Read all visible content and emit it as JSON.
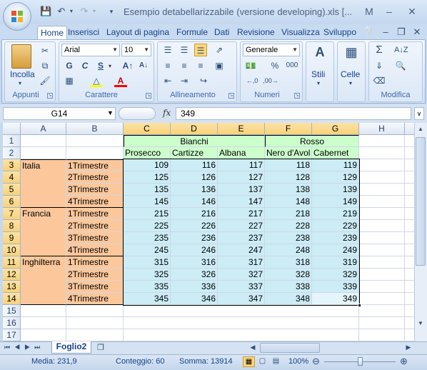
{
  "window": {
    "title": "Esempio detabellarizzabile (versione developing).xls  [...",
    "min_label": "M",
    "restore_label": "–",
    "close_label": "✕"
  },
  "tabs": [
    "Home",
    "Inserisci",
    "Layout di pagina",
    "Formule",
    "Dati",
    "Revisione",
    "Visualizza",
    "Sviluppo"
  ],
  "ribbon": {
    "clipboard": {
      "paste_label": "Incolla",
      "group_label": "Appunti"
    },
    "font": {
      "font_name": "Arial",
      "font_size": "10",
      "group_label": "Carattere",
      "bold": "G",
      "italic": "C",
      "underline": "S"
    },
    "alignment": {
      "group_label": "Allineamento"
    },
    "number": {
      "format": "Generale",
      "percent": "%",
      "thousands": "000",
      "group_label": "Numeri"
    },
    "styles": {
      "label": "Stili"
    },
    "cells": {
      "label": "Celle"
    },
    "editing": {
      "group_label": "Modifica"
    }
  },
  "formula": {
    "name_box": "G14",
    "fx_label": "fx",
    "value": "349"
  },
  "columns": [
    "A",
    "B",
    "C",
    "D",
    "E",
    "F",
    "G",
    "H"
  ],
  "rows": [
    "1",
    "2",
    "3",
    "4",
    "5",
    "6",
    "7",
    "8",
    "9",
    "10",
    "11",
    "12",
    "13",
    "14",
    "15",
    "16",
    "17"
  ],
  "header1": {
    "bianchi": "Bianchi",
    "rosso": "Rosso"
  },
  "header2": [
    "Prosecco",
    "Cartizze",
    "Albana",
    "Nero d'Avol",
    "Cabernet"
  ],
  "countries": [
    "Italia",
    "Francia",
    "Inghilterra"
  ],
  "quarters": [
    "1Trimestre",
    "2Trimestre",
    "3Trimestre",
    "4Trimestre"
  ],
  "table": [
    [
      "109",
      "116",
      "117",
      "118",
      "119"
    ],
    [
      "125",
      "126",
      "127",
      "128",
      "129"
    ],
    [
      "135",
      "136",
      "137",
      "138",
      "139"
    ],
    [
      "145",
      "146",
      "147",
      "148",
      "149"
    ],
    [
      "215",
      "216",
      "217",
      "218",
      "219"
    ],
    [
      "225",
      "226",
      "227",
      "228",
      "229"
    ],
    [
      "235",
      "236",
      "237",
      "238",
      "239"
    ],
    [
      "245",
      "246",
      "247",
      "248",
      "249"
    ],
    [
      "315",
      "316",
      "317",
      "318",
      "319"
    ],
    [
      "325",
      "326",
      "327",
      "328",
      "329"
    ],
    [
      "335",
      "336",
      "337",
      "338",
      "339"
    ],
    [
      "345",
      "346",
      "347",
      "348",
      "349"
    ]
  ],
  "sheet": {
    "tab_name": "Foglio2"
  },
  "status": {
    "media": "Media: 231,9",
    "conteggio": "Conteggio: 60",
    "somma": "Somma: 13914",
    "zoom": "100%"
  },
  "colors": {
    "header_green": "#ccffcc",
    "data_blue": "#ccecf6",
    "label_orange": "#fcc89b"
  }
}
